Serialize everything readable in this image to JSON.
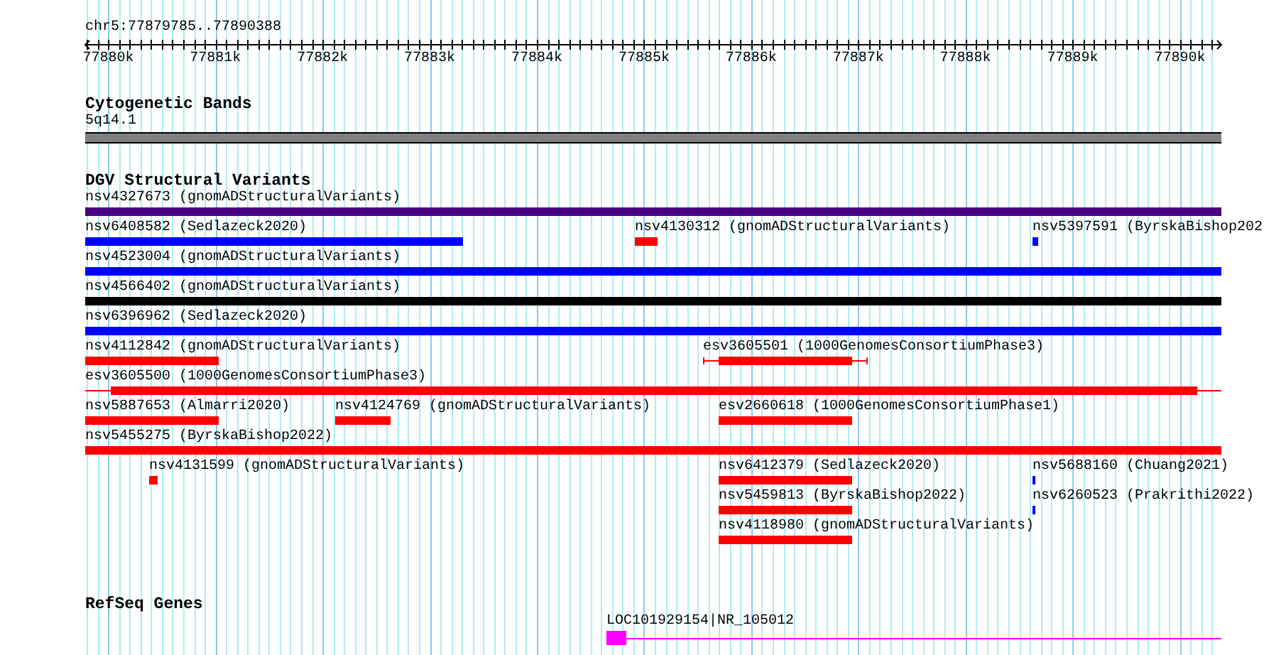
{
  "ruler": {
    "label": "chr5:77879785..77890388",
    "ticks": [
      "77880k",
      "77881k",
      "77882k",
      "77883k",
      "77884k",
      "77885k",
      "77886k",
      "77887k",
      "77888k",
      "77889k",
      "77890k"
    ]
  },
  "tracks": [
    {
      "kind": "cytoband",
      "title": "Cytogenetic Bands",
      "bands": [
        {
          "name": "5q14.1"
        }
      ]
    },
    {
      "kind": "variants",
      "title": "DGV Structural Variants",
      "rows": [
        {
          "features": [
            {
              "label": "nsv4327673 (gnomADStructuralVariants)",
              "color": "#4b0082"
            }
          ]
        },
        {
          "features": [
            {
              "label": "nsv6408582 (Sedlazeck2020)",
              "color": "#0000ff"
            },
            {
              "label": "nsv4130312 (gnomADStructuralVariants)",
              "color": "#ff0000"
            },
            {
              "label": "nsv5397591 (ByrskaBishop202",
              "color": "#0000ff"
            }
          ]
        },
        {
          "features": [
            {
              "label": "nsv4523004 (gnomADStructuralVariants)",
              "color": "#0000ff"
            }
          ]
        },
        {
          "features": [
            {
              "label": "nsv4566402 (gnomADStructuralVariants)",
              "color": "#000000"
            }
          ]
        },
        {
          "features": [
            {
              "label": "nsv6396962 (Sedlazeck2020)",
              "color": "#0000ff"
            }
          ]
        },
        {
          "features": [
            {
              "label": "nsv4112842 (gnomADStructuralVariants)",
              "color": "#ff0000"
            },
            {
              "label": "esv3605501 (1000GenomesConsortiumPhase3)",
              "color": "#ff0000"
            }
          ]
        },
        {
          "features": [
            {
              "label": "esv3605500 (1000GenomesConsortiumPhase3)",
              "color": "#ff0000"
            }
          ]
        },
        {
          "features": [
            {
              "label": "nsv5887653 (Almarri2020)",
              "color": "#ff0000"
            },
            {
              "label": "nsv4124769 (gnomADStructuralVariants)",
              "color": "#ff0000"
            },
            {
              "label": "esv2660618 (1000GenomesConsortiumPhase1)",
              "color": "#ff0000"
            }
          ]
        },
        {
          "features": [
            {
              "label": "nsv5455275 (ByrskaBishop2022)",
              "color": "#ff0000"
            }
          ]
        },
        {
          "features": [
            {
              "label": "nsv4131599 (gnomADStructuralVariants)",
              "color": "#ff0000"
            },
            {
              "label": "nsv6412379 (Sedlazeck2020)",
              "color": "#ff0000"
            },
            {
              "label": "nsv5688160 (Chuang2021)",
              "color": "#0000ff"
            }
          ]
        },
        {
          "features": [
            {
              "label": "nsv5459813 (ByrskaBishop2022)",
              "color": "#ff0000"
            },
            {
              "label": "nsv6260523 (Prakrithi2022)",
              "color": "#0000ff"
            }
          ]
        },
        {
          "features": [
            {
              "label": "nsv4118980 (gnomADStructuralVariants)",
              "color": "#ff0000"
            }
          ]
        }
      ]
    },
    {
      "kind": "genes",
      "title": "RefSeq Genes",
      "genes": [
        {
          "label": "LOC101929154|NR_105012"
        }
      ]
    }
  ]
}
